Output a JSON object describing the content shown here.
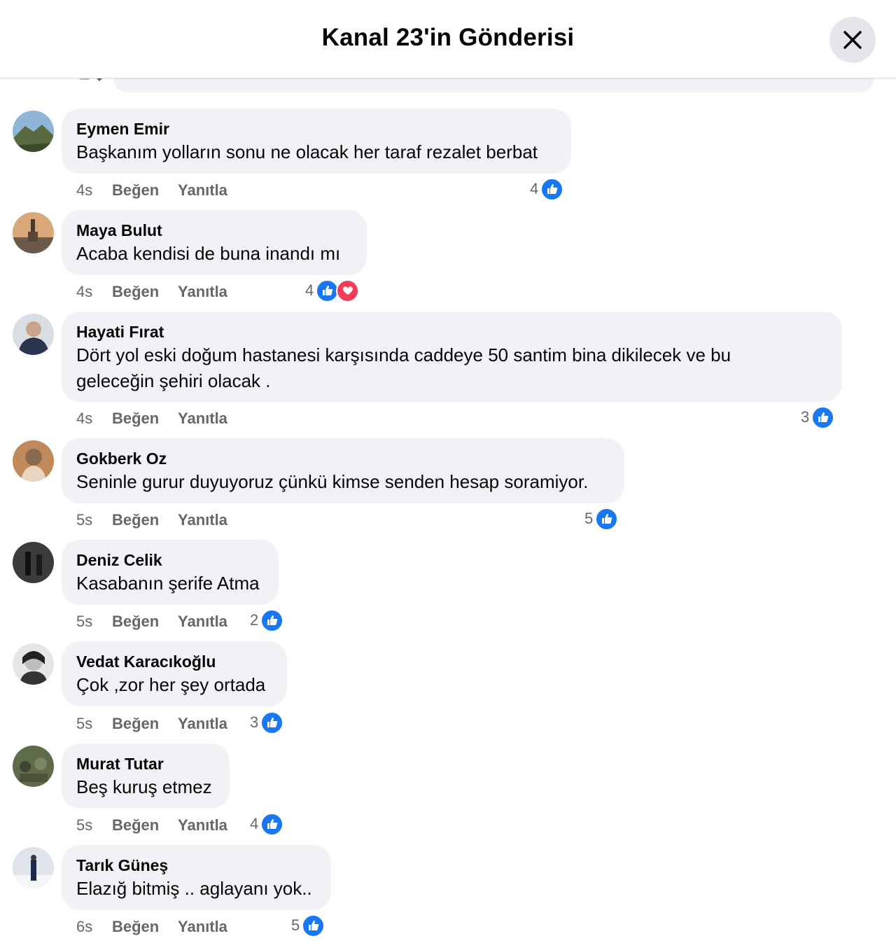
{
  "header": {
    "title": "Kanal 23'in Gönderisi"
  },
  "comments": [
    {
      "author": "Eymen Emir",
      "text": "Başkanım yolların sonu ne olacak her taraf rezalet berbat",
      "time": "4s",
      "like_label": "Beğen",
      "reply_label": "Yanıtla",
      "reaction_count": "4",
      "reactions": [
        "like-icon"
      ]
    },
    {
      "author": "Maya Bulut",
      "text": "Acaba kendisi de buna inandı mı",
      "time": "4s",
      "like_label": "Beğen",
      "reply_label": "Yanıtla",
      "reaction_count": "4",
      "reactions": [
        "like-icon",
        "love-icon"
      ]
    },
    {
      "author": "Hayati Fırat",
      "text": "Dört yol eski doğum hastanesi karşısında caddeye 50 santim bina dikilecek ve bu",
      "text2": "geleceğin şehiri olacak .",
      "time": "4s",
      "like_label": "Beğen",
      "reply_label": "Yanıtla",
      "reaction_count": "3",
      "reactions": [
        "like-icon"
      ]
    },
    {
      "author": "Gokberk Oz",
      "text": "Seninle gurur duyuyoruz çünkü kimse senden hesap soramiyor.",
      "time": "5s",
      "like_label": "Beğen",
      "reply_label": "Yanıtla",
      "reaction_count": "5",
      "reactions": [
        "like-icon"
      ]
    },
    {
      "author": "Deniz Celik",
      "text": "Kasabanın şerife Atma",
      "time": "5s",
      "like_label": "Beğen",
      "reply_label": "Yanıtla",
      "reaction_count": "2",
      "reactions": [
        "like-icon"
      ]
    },
    {
      "author": "Vedat Karacıkoğlu",
      "text": "Çok ,zor her şey ortada",
      "time": "5s",
      "like_label": "Beğen",
      "reply_label": "Yanıtla",
      "reaction_count": "3",
      "reactions": [
        "like-icon"
      ]
    },
    {
      "author": "Murat Tutar",
      "text": "Beş kuruş etmez",
      "time": "5s",
      "like_label": "Beğen",
      "reply_label": "Yanıtla",
      "reaction_count": "4",
      "reactions": [
        "like-icon"
      ]
    },
    {
      "author": "Tarık Güneş",
      "text": "Elazığ bitmiş .. aglayanı yok..",
      "time": "6s",
      "like_label": "Beğen",
      "reply_label": "Yanıtla",
      "reaction_count": "5",
      "reactions": [
        "like-icon"
      ]
    }
  ],
  "colors": {
    "like": "#1877f2",
    "love": "#f33e58",
    "bubble": "#f0f2f5",
    "meta": "#65676b"
  }
}
